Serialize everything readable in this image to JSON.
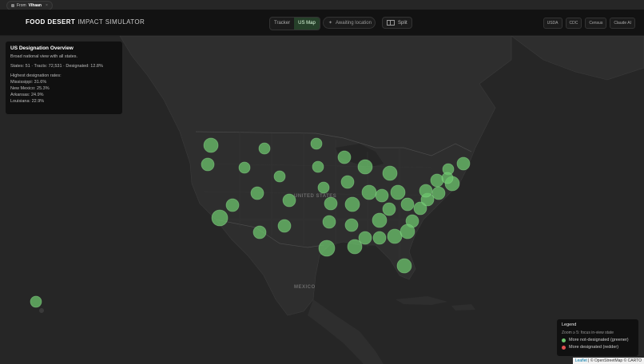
{
  "from_pill": {
    "prefix": "From",
    "name": "Vihaan",
    "close": "×"
  },
  "app": {
    "title_strong": "FOOD DESERT",
    "title_light": "IMPACT SIMULATOR"
  },
  "views": [
    {
      "label": "Tracker",
      "active": false
    },
    {
      "label": "US Map",
      "active": true
    }
  ],
  "location": {
    "label": "Awaiting location"
  },
  "split": {
    "label": "Split"
  },
  "sources": [
    "USDA",
    "CDC",
    "Census",
    "Claude AI"
  ],
  "overview": {
    "title": "US Designation Overview",
    "subtitle": "Broad national view with all states.",
    "stats": "States: 51 · Tracts: 72,531 · Designated: 12.8%",
    "highest_label": "Highest designation rates:",
    "highest": [
      "Mississippi: 31.6%",
      "New Mexico: 25.3%",
      "Arkansas: 24.9%",
      "Louisiana: 22.9%"
    ]
  },
  "map_labels": {
    "us": "UNITED STATES",
    "mexico": "MEXICO"
  },
  "legend": {
    "title": "Legend",
    "subtitle": "Zoom ≥ 5: focus in-view state",
    "items": [
      {
        "label": "More not-designated (greener)",
        "color": "#6cc46c"
      },
      {
        "label": "More designated (redder)",
        "color": "#e05050"
      }
    ]
  },
  "attribution": {
    "leaflet": "Leaflet",
    "rest": " | © OpenStreetMap © CARTO"
  }
}
